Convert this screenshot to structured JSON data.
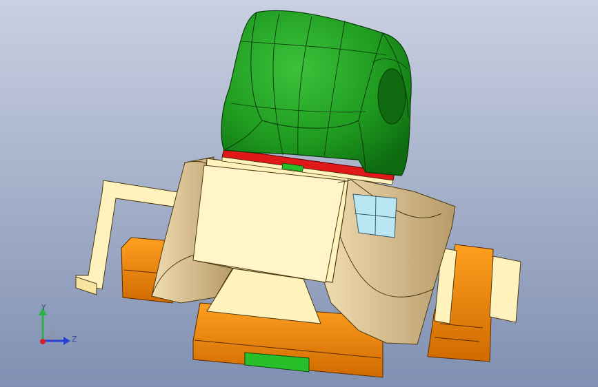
{
  "viewport": {
    "background_top": "#c5cde0",
    "background_bottom": "#7e8db0"
  },
  "triad": {
    "y_label": "Y",
    "z_label": "Z",
    "y_color": "#2bb34a",
    "z_color": "#2a3fd8",
    "x_color": "#d8202a"
  },
  "colors": {
    "cover_green": "#1f8f1f",
    "cover_green_light": "#4fc44f",
    "seal_red": "#e01818",
    "body_cream": "#fff2bd",
    "saddle_tan": "#dcc49a",
    "pipe_orange": "#f08a00",
    "window_blue": "#b9e6f2",
    "base_green": "#27c02b"
  }
}
